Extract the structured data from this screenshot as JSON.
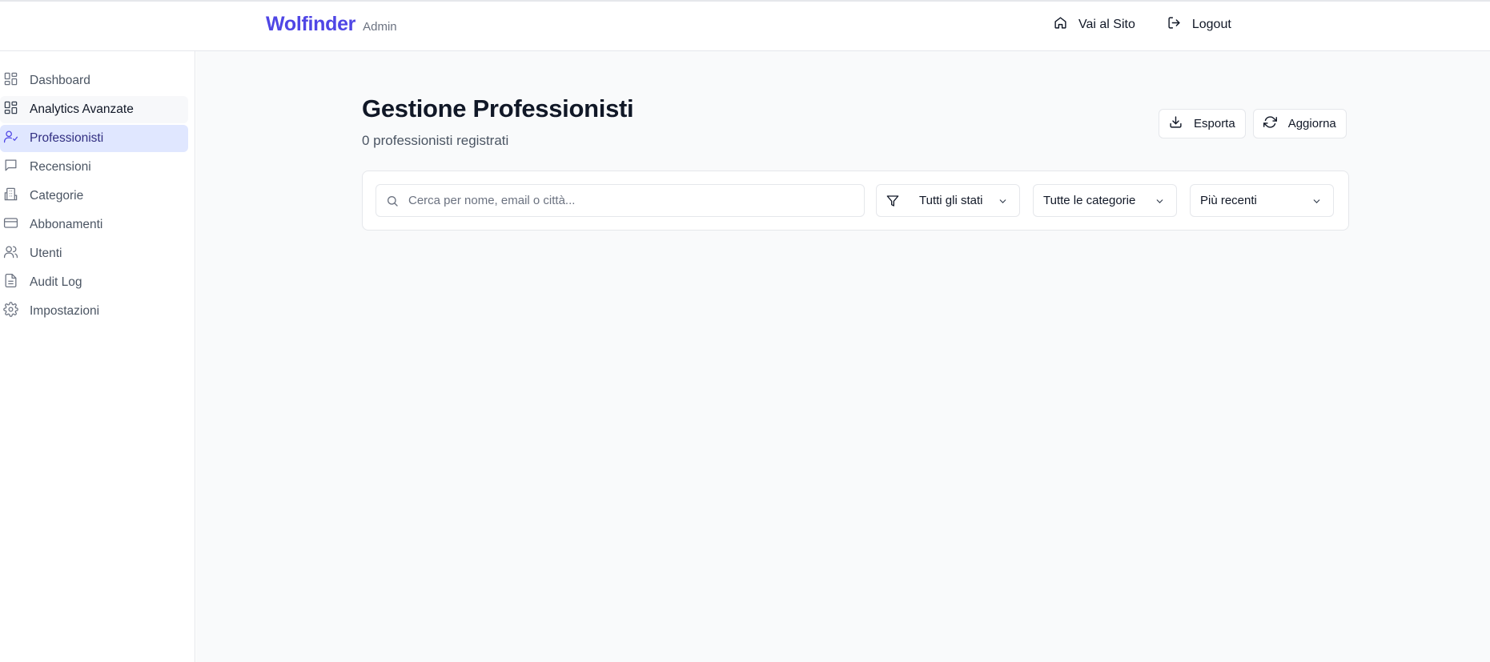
{
  "header": {
    "brand": "Wolfinder",
    "brand_sub": "Admin",
    "links": [
      {
        "label": "Vai al Sito",
        "icon": "home-icon"
      },
      {
        "label": "Logout",
        "icon": "logout-icon"
      }
    ]
  },
  "sidebar": {
    "items": [
      {
        "label": "Dashboard",
        "icon": "dashboard-icon"
      },
      {
        "label": "Analytics Avanzate",
        "icon": "analytics-icon"
      },
      {
        "label": "Professionisti",
        "icon": "user-check-icon",
        "active": true
      },
      {
        "label": "Recensioni",
        "icon": "message-icon"
      },
      {
        "label": "Categorie",
        "icon": "building-icon"
      },
      {
        "label": "Abbonamenti",
        "icon": "credit-card-icon"
      },
      {
        "label": "Utenti",
        "icon": "users-icon"
      },
      {
        "label": "Audit Log",
        "icon": "file-text-icon"
      },
      {
        "label": "Impostazioni",
        "icon": "gear-icon"
      }
    ]
  },
  "main": {
    "title": "Gestione Professionisti",
    "subtitle": "0 professionisti registrati",
    "actions": {
      "export_label": "Esporta",
      "refresh_label": "Aggiorna"
    },
    "filters": {
      "search_placeholder": "Cerca per nome, email o città...",
      "status_value": "Tutti gli stati",
      "category_value": "Tutte le categorie",
      "sort_value": "Più recenti"
    }
  },
  "colors": {
    "accent": "#4f46e5",
    "active_bg": "#e0e7ff",
    "active_text": "#312e81",
    "main_bg": "#f9fafb",
    "border": "#e5e7eb"
  }
}
